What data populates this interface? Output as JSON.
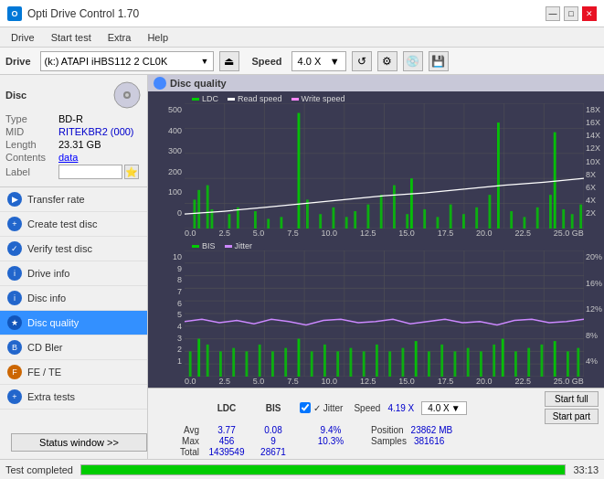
{
  "app": {
    "title": "Opti Drive Control 1.70",
    "icon": "O"
  },
  "titlebar": {
    "minimize": "—",
    "maximize": "□",
    "close": "✕"
  },
  "menu": {
    "items": [
      "Drive",
      "Start test",
      "Extra",
      "Help"
    ]
  },
  "toolbar": {
    "drive_label": "Drive",
    "drive_value": "(k:)  ATAPI iHBS112  2 CL0K",
    "speed_label": "Speed",
    "speed_value": "4.0 X"
  },
  "disc": {
    "header": "Disc",
    "type_label": "Type",
    "type_value": "BD-R",
    "mid_label": "MID",
    "mid_value": "RITEKBR2 (000)",
    "length_label": "Length",
    "length_value": "23.31 GB",
    "contents_label": "Contents",
    "contents_value": "data",
    "label_label": "Label",
    "label_placeholder": ""
  },
  "nav": {
    "items": [
      {
        "id": "transfer-rate",
        "label": "Transfer rate",
        "active": false
      },
      {
        "id": "create-test-disc",
        "label": "Create test disc",
        "active": false
      },
      {
        "id": "verify-test-disc",
        "label": "Verify test disc",
        "active": false
      },
      {
        "id": "drive-info",
        "label": "Drive info",
        "active": false
      },
      {
        "id": "disc-info",
        "label": "Disc info",
        "active": false
      },
      {
        "id": "disc-quality",
        "label": "Disc quality",
        "active": true
      },
      {
        "id": "cd-bler",
        "label": "CD Bler",
        "active": false
      },
      {
        "id": "fe-te",
        "label": "FE / TE",
        "active": false
      },
      {
        "id": "extra-tests",
        "label": "Extra tests",
        "active": false
      }
    ]
  },
  "status_btn": "Status window >>",
  "panel": {
    "title": "Disc quality",
    "legend": {
      "ldc": "LDC",
      "read_speed": "Read speed",
      "write_speed": "Write speed"
    },
    "legend2": {
      "bis": "BIS",
      "jitter": "Jitter"
    },
    "chart1": {
      "y_labels": [
        "500",
        "400",
        "300",
        "200",
        "100",
        "0"
      ],
      "y_right_labels": [
        "18X",
        "16X",
        "14X",
        "12X",
        "10X",
        "8X",
        "6X",
        "4X",
        "2X"
      ],
      "x_labels": [
        "0.0",
        "2.5",
        "5.0",
        "7.5",
        "10.0",
        "12.5",
        "15.0",
        "17.5",
        "20.0",
        "22.5",
        "25.0 GB"
      ]
    },
    "chart2": {
      "y_labels": [
        "10",
        "9",
        "8",
        "7",
        "6",
        "5",
        "4",
        "3",
        "2",
        "1"
      ],
      "y_right_labels": [
        "20%",
        "16%",
        "12%",
        "8%",
        "4%"
      ],
      "x_labels": [
        "0.0",
        "2.5",
        "5.0",
        "7.5",
        "10.0",
        "12.5",
        "15.0",
        "17.5",
        "20.0",
        "22.5",
        "25.0 GB"
      ]
    }
  },
  "stats": {
    "ldc_header": "LDC",
    "bis_header": "BIS",
    "jitter_label": "✓ Jitter",
    "speed_label": "Speed",
    "speed_value": "4.19 X",
    "speed_select": "4.0 X",
    "avg_label": "Avg",
    "avg_ldc": "3.77",
    "avg_bis": "0.08",
    "avg_jitter": "9.4%",
    "max_label": "Max",
    "max_ldc": "456",
    "max_bis": "9",
    "max_jitter": "10.3%",
    "total_label": "Total",
    "total_ldc": "1439549",
    "total_bis": "28671",
    "position_label": "Position",
    "position_value": "23862 MB",
    "samples_label": "Samples",
    "samples_value": "381616",
    "start_full_btn": "Start full",
    "start_part_btn": "Start part"
  },
  "bottom": {
    "status_text": "Test completed",
    "progress_pct": 100,
    "time": "33:13"
  }
}
